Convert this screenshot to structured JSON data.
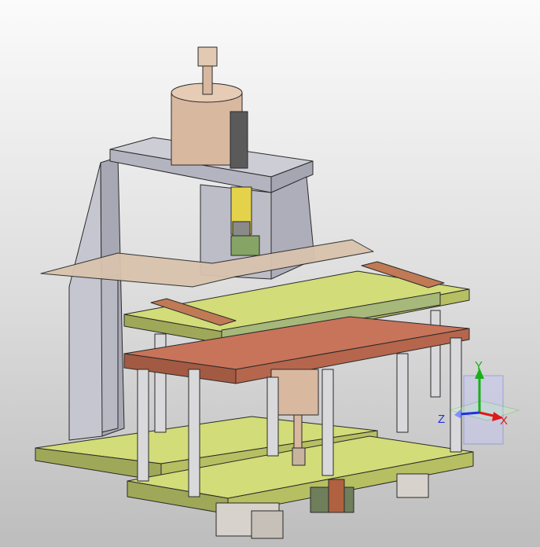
{
  "viewport": {
    "background_top": "#fbfbfb",
    "background_bottom": "#bdbdbd"
  },
  "model": {
    "colors": {
      "plate_yellow": "#d2dc78",
      "plate_copper": "#c8745a",
      "frame_gray": "#b9b9c4",
      "rod_steel": "#d9d9dc",
      "cylinder_bronze": "#d9b8a0",
      "sensor_yellow": "#e4d24a",
      "guide_green": "#86a466"
    }
  },
  "triad": {
    "y_label": "Y",
    "z_label": "Z",
    "x_label": "X",
    "colors": {
      "x": "#e01818",
      "y": "#18b018",
      "z": "#2030e0"
    }
  }
}
